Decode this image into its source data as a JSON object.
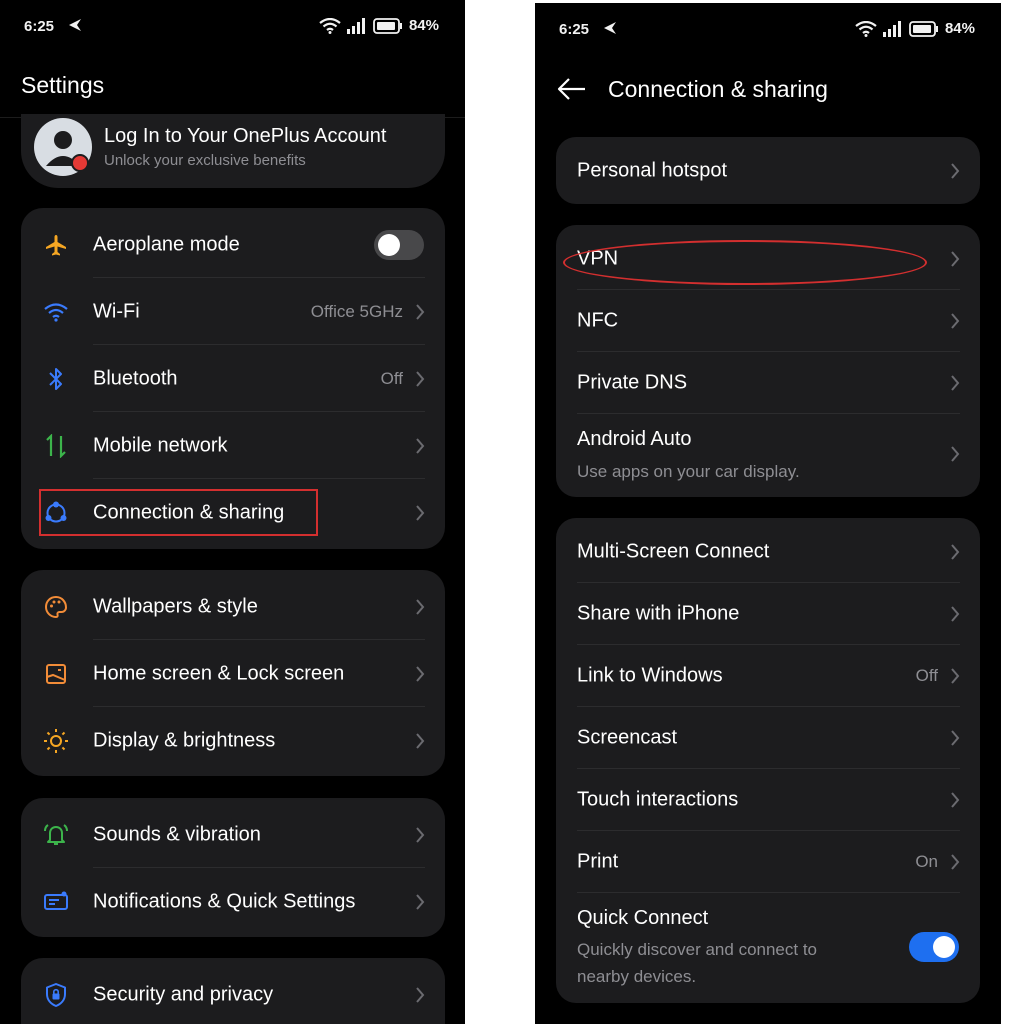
{
  "left": {
    "status": {
      "time": "6:25",
      "battery": "84%"
    },
    "title": "Settings",
    "account": {
      "title": "Log In to Your OnePlus Account",
      "subtitle": "Unlock your exclusive benefits"
    },
    "group1": [
      {
        "label": "Aeroplane mode",
        "icon": "airplane-icon",
        "toggle": false
      },
      {
        "label": "Wi-Fi",
        "icon": "wifi-icon",
        "value": "Office 5GHz"
      },
      {
        "label": "Bluetooth",
        "icon": "bluetooth-icon",
        "value": "Off"
      },
      {
        "label": "Mobile network",
        "icon": "mobile-data-icon"
      },
      {
        "label": "Connection & sharing",
        "icon": "connection-sharing-icon",
        "highlighted": true
      }
    ],
    "group2": [
      {
        "label": "Wallpapers & style",
        "icon": "palette-icon"
      },
      {
        "label": "Home screen & Lock screen",
        "icon": "home-screen-icon"
      },
      {
        "label": "Display & brightness",
        "icon": "sun-icon"
      }
    ],
    "group3": [
      {
        "label": "Sounds & vibration",
        "icon": "bell-icon"
      },
      {
        "label": "Notifications & Quick Settings",
        "icon": "notifications-icon"
      }
    ],
    "group4": [
      {
        "label": "Security and privacy",
        "icon": "shield-icon"
      }
    ]
  },
  "right": {
    "status": {
      "time": "6:25",
      "battery": "84%"
    },
    "title": "Connection & sharing",
    "group1": [
      {
        "label": "Personal hotspot"
      }
    ],
    "group2": [
      {
        "label": "VPN",
        "highlighted": true
      },
      {
        "label": "NFC"
      },
      {
        "label": "Private DNS"
      },
      {
        "label": "Android Auto",
        "subtitle": "Use apps on your car display."
      }
    ],
    "group3": [
      {
        "label": "Multi-Screen Connect"
      },
      {
        "label": "Share with iPhone"
      },
      {
        "label": "Link to Windows",
        "value": "Off"
      },
      {
        "label": "Screencast"
      },
      {
        "label": "Touch interactions"
      },
      {
        "label": "Print",
        "value": "On"
      },
      {
        "label": "Quick Connect",
        "subtitle_line1": "Quickly discover and connect to",
        "subtitle_line2": "nearby devices.",
        "toggle": true
      }
    ]
  },
  "colors": {
    "background": "#000000",
    "card": "#1c1c1e",
    "accent_blue": "#1e6ff0",
    "highlight_red": "#d32f2f",
    "secondary_text": "#8e8e93"
  }
}
